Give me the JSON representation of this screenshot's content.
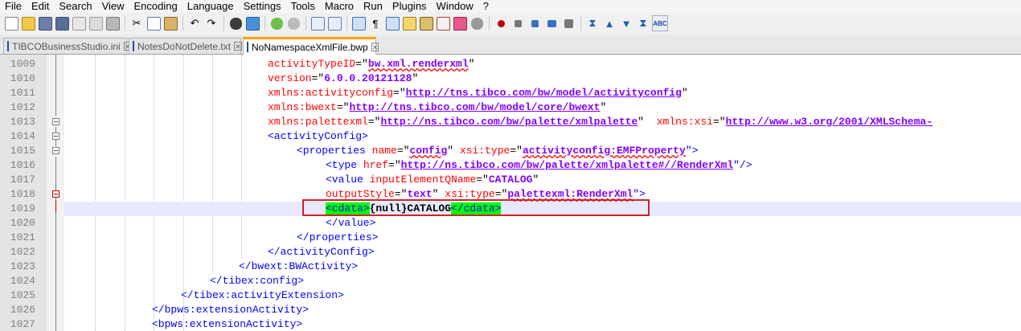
{
  "menu": [
    "File",
    "Edit",
    "Search",
    "View",
    "Encoding",
    "Language",
    "Settings",
    "Tools",
    "Macro",
    "Run",
    "Plugins",
    "Window",
    "?"
  ],
  "tabs": [
    {
      "label": "TIBCOBusinessStudio.ini"
    },
    {
      "label": "NotesDoNotDelete.txt"
    },
    {
      "label": "NoNamespaceXmlFile.bwp"
    }
  ],
  "code": {
    "l1009": {
      "num": "1009",
      "attr": "activityTypeID",
      "eq": "=\"",
      "val": "bw.xml.renderxml",
      "end": "\""
    },
    "l1010": {
      "num": "1010",
      "attr": "version",
      "eq": "=\"",
      "val": "6.0.0.20121128",
      "end": "\""
    },
    "l1011": {
      "num": "1011",
      "attr": "xmlns:activityconfig",
      "eq": "=\"",
      "val": "http://tns.tibco.com/bw/model/activityconfig",
      "end": "\""
    },
    "l1012": {
      "num": "1012",
      "attr": "xmlns:bwext",
      "eq": "=\"",
      "val": "http://tns.tibco.com/bw/model/core/bwext",
      "end": "\""
    },
    "l1013": {
      "num": "1013",
      "attr": "xmlns:palettexml",
      "eq": "=\"",
      "val": "http://ns.tibco.com/bw/palette/xmlpalette",
      "end": "\"",
      "attr2": "xmlns:xsi",
      "eq2": "=\"",
      "val2": "http://www.w3.org/2001/XMLSchema-"
    },
    "l1014": {
      "num": "1014",
      "tag": "<activityConfig>"
    },
    "l1015": {
      "num": "1015",
      "tagopen": "<properties",
      "attr": "name",
      "eq": "=\"",
      "val": "config",
      "end": "\"",
      "attr2": "xsi:type",
      "eq2": "=\"",
      "val2": "activityconfig:EMFProperty",
      "end2": "\">"
    },
    "l1016": {
      "num": "1016",
      "tagopen": "<type",
      "attr": "href",
      "eq": "=\"",
      "val": "http://ns.tibco.com/bw/palette/xmlpalette#//RenderXml",
      "end": "\"/>"
    },
    "l1017": {
      "num": "1017",
      "tagopen": "<value",
      "attr": "inputElementQName",
      "eq": "=\"",
      "val": "CATALOG",
      "end": "\""
    },
    "l1018": {
      "num": "1018",
      "attr": "outputStyle",
      "eq": "=\"",
      "val": "text",
      "end": "\"",
      "attr2": "xsi:type",
      "eq2": "=\"",
      "val2": "palettexml:RenderXml",
      "end2": "\">"
    },
    "l1019": {
      "num": "1019",
      "open": "<cdata>",
      "text": "{null}CATALOG",
      "close": "</cdata>"
    },
    "l1020": {
      "num": "1020",
      "tag": "</value>"
    },
    "l1021": {
      "num": "1021",
      "tag": "</properties>"
    },
    "l1022": {
      "num": "1022",
      "tag": "</activityConfig>"
    },
    "l1023": {
      "num": "1023",
      "tag": "</bwext:BWActivity>"
    },
    "l1024": {
      "num": "1024",
      "tag": "</tibex:config>"
    },
    "l1025": {
      "num": "1025",
      "tag": "</tibex:activityExtension>"
    },
    "l1026": {
      "num": "1026",
      "tag": "</bpws:extensionActivity>"
    },
    "l1027": {
      "num": "1027",
      "tag": "<bpws:extensionActivity>"
    }
  }
}
